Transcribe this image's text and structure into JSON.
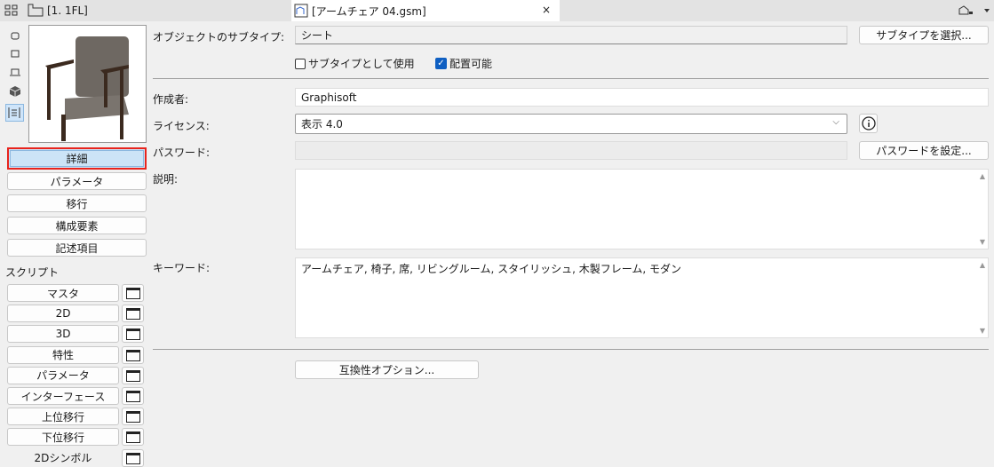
{
  "tabs": {
    "left": "[1. 1FL]",
    "active": "[アームチェア 04.gsm]",
    "close": "×"
  },
  "sidebar": {
    "buttons": [
      "詳細",
      "パラメータ",
      "移行",
      "構成要素",
      "記述項目"
    ],
    "scripts_label": "スクリプト",
    "scripts": [
      "マスタ",
      "2D",
      "3D",
      "特性",
      "パラメータ",
      "インターフェース",
      "上位移行",
      "下位移行",
      "2Dシンボル"
    ]
  },
  "form": {
    "subtype_label": "オブジェクトのサブタイプ:",
    "subtype_value": "シート",
    "select_subtype": "サブタイプを選択...",
    "use_as_subtype": "サブタイプとして使用",
    "use_as_subtype_checked": false,
    "placeable": "配置可能",
    "placeable_checked": true,
    "author_label": "作成者:",
    "author_value": "Graphisoft",
    "license_label": "ライセンス:",
    "license_value": "表示 4.0",
    "password_label": "パスワード:",
    "password_value": "",
    "set_password": "パスワードを設定...",
    "description_label": "説明:",
    "description_value": "",
    "keywords_label": "キーワード:",
    "keywords_value": "アームチェア, 椅子, 席, リビングルーム, スタイリッシュ, 木製フレーム, モダン",
    "compat_button": "互換性オプション..."
  }
}
